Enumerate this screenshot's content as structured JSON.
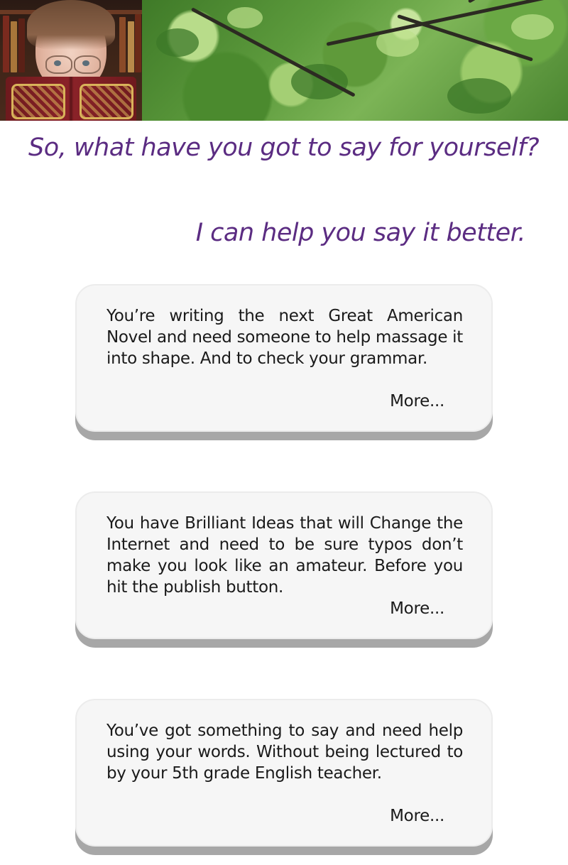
{
  "header": {
    "portrait_alt": "woman reading a book",
    "banner_alt": "tree canopy"
  },
  "hero": {
    "line1": "So, what have you got to say for yourself?",
    "line2": "I can help you say it better."
  },
  "cards": [
    {
      "text": "You’re writing the next Great American Novel and need someone to help massage it into shape. And to check your grammar.",
      "more_label": "More..."
    },
    {
      "text": "You have Brilliant Ideas that will Change the Internet and need to be sure typos don’t make you look like an amateur. Before you hit the publish button.",
      "more_label": "More..."
    },
    {
      "text": "You’ve got something to say and need help using your words. Without being lectured to by your 5th grade English teacher.",
      "more_label": "More..."
    }
  ],
  "colors": {
    "headline": "#5b2c82",
    "card_bg": "#f6f6f6",
    "card_shadow": "#a7a7a7",
    "body_text": "#1a1a1a"
  }
}
